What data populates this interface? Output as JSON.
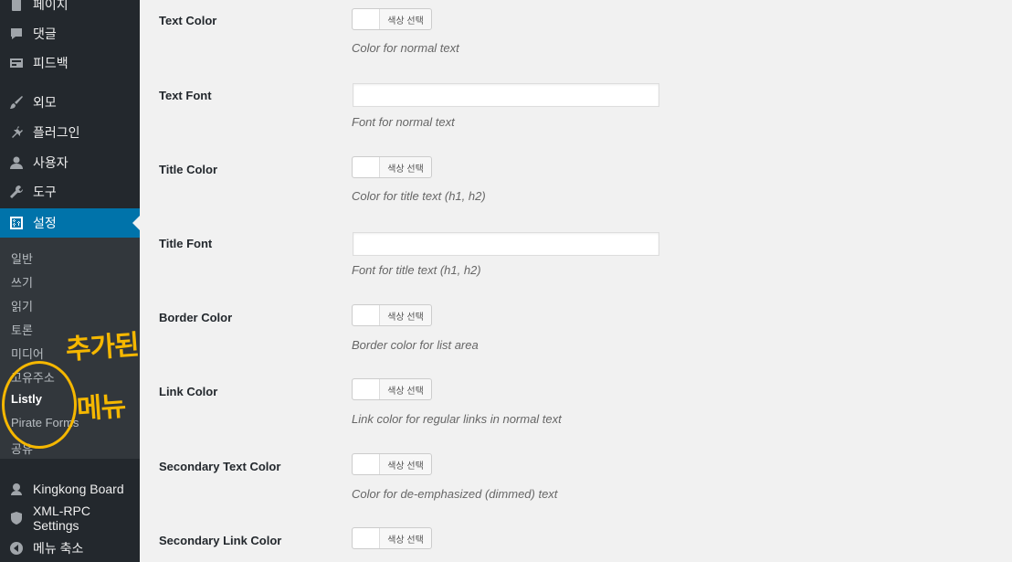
{
  "sidebar": {
    "top_items": [
      {
        "label": "페이지",
        "icon": "page-icon"
      },
      {
        "label": "댓글",
        "icon": "comment-icon"
      },
      {
        "label": "피드백",
        "icon": "feedback-icon"
      },
      {
        "label": "외모",
        "icon": "brush-icon"
      },
      {
        "label": "플러그인",
        "icon": "plugin-icon"
      },
      {
        "label": "사용자",
        "icon": "user-icon"
      },
      {
        "label": "도구",
        "icon": "wrench-icon"
      },
      {
        "label": "설정",
        "icon": "settings-icon"
      }
    ],
    "sub_items": [
      {
        "label": "일반"
      },
      {
        "label": "쓰기"
      },
      {
        "label": "읽기"
      },
      {
        "label": "토론"
      },
      {
        "label": "미디어"
      },
      {
        "label": "고유주소"
      },
      {
        "label": "Listly"
      },
      {
        "label": "Pirate Forms"
      },
      {
        "label": "공유"
      }
    ],
    "bottom_items": [
      {
        "label": "Kingkong Board",
        "icon": "kingkong-icon"
      },
      {
        "label": "XML-RPC Settings",
        "icon": "shield-icon"
      },
      {
        "label": "메뉴 축소",
        "icon": "collapse-icon"
      }
    ]
  },
  "annotation": {
    "line1": "추가된",
    "line2": "메뉴",
    "color": "#f5b700"
  },
  "settings": [
    {
      "label": "Text Color",
      "type": "color",
      "button": "색상 선택",
      "description": "Color for normal text"
    },
    {
      "label": "Text Font",
      "type": "text",
      "value": "",
      "description": "Font for normal text"
    },
    {
      "label": "Title Color",
      "type": "color",
      "button": "색상 선택",
      "description": "Color for title text (h1, h2)"
    },
    {
      "label": "Title Font",
      "type": "text",
      "value": "",
      "description": "Font for title text (h1, h2)"
    },
    {
      "label": "Border Color",
      "type": "color",
      "button": "색상 선택",
      "description": "Border color for list area"
    },
    {
      "label": "Link Color",
      "type": "color",
      "button": "색상 선택",
      "description": "Link color for regular links in normal text"
    },
    {
      "label": "Secondary Text Color",
      "type": "color",
      "button": "색상 선택",
      "description": "Color for de-emphasized (dimmed) text"
    },
    {
      "label": "Secondary Link Color",
      "type": "color",
      "button": "색상 선택",
      "description": ""
    }
  ],
  "colors": {
    "sidebar_bg": "#23282d",
    "submenu_bg": "#32373c",
    "active": "#0073aa",
    "content_bg": "#f1f1f1"
  }
}
